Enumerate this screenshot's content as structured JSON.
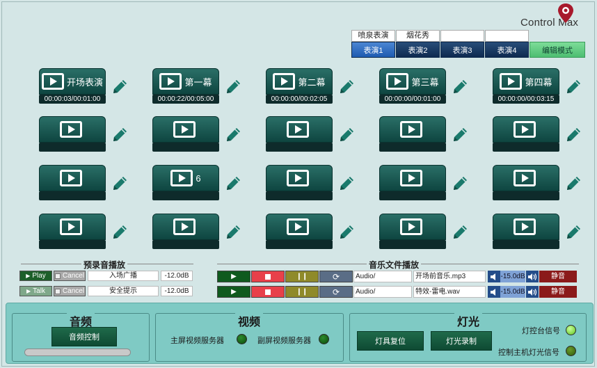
{
  "brand": {
    "logo_text": "Control Max"
  },
  "shows": {
    "names": [
      "喷泉表演",
      "烟花秀",
      "",
      ""
    ],
    "tabs": [
      "表演1",
      "表演2",
      "表演3",
      "表演4"
    ],
    "active_tab": 0,
    "edit_mode_label": "编辑模式"
  },
  "cues": [
    [
      {
        "label": "开场表演",
        "time": "00:00:03/00:01:00"
      },
      {
        "label": "第一幕",
        "time": "00:00:22/00:05:00"
      },
      {
        "label": "第二幕",
        "time": "00:00:00/00:02:05"
      },
      {
        "label": "第三幕",
        "time": "00:00:00/00:01:00"
      },
      {
        "label": "第四幕",
        "time": "00:00:00/00:03:15"
      }
    ],
    [
      {
        "label": "",
        "time": ""
      },
      {
        "label": "",
        "time": ""
      },
      {
        "label": "",
        "time": ""
      },
      {
        "label": "",
        "time": ""
      },
      {
        "label": "",
        "time": ""
      }
    ],
    [
      {
        "label": "",
        "time": ""
      },
      {
        "label": "6",
        "time": ""
      },
      {
        "label": "",
        "time": ""
      },
      {
        "label": "",
        "time": ""
      },
      {
        "label": "",
        "time": ""
      }
    ],
    [
      {
        "label": "",
        "time": ""
      },
      {
        "label": "",
        "time": ""
      },
      {
        "label": "",
        "time": ""
      },
      {
        "label": "",
        "time": ""
      },
      {
        "label": "",
        "time": ""
      }
    ]
  ],
  "prerecorded": {
    "title": "预录音播放",
    "rows": [
      {
        "action": "Play",
        "cancel": "Cancel",
        "name": "入场广播",
        "db": "-12.0dB"
      },
      {
        "action": "Talk",
        "cancel": "Cancel",
        "name": "安全提示",
        "db": "-12.0dB"
      }
    ]
  },
  "music": {
    "title": "音乐文件播放",
    "rows": [
      {
        "path": "Audio/",
        "file": "开场前音乐.mp3",
        "volume": "-15.0dB",
        "mute": "静音"
      },
      {
        "path": "Audio/",
        "file": "特效-雷电.wav",
        "volume": "-15.0dB",
        "mute": "静音"
      }
    ]
  },
  "audio_group": {
    "title": "音频",
    "button": "音频控制"
  },
  "video_group": {
    "title": "视频",
    "main_server": "主屏视频服务器",
    "sub_server": "副屏视频服务器"
  },
  "light_group": {
    "title": "灯光",
    "reset": "灯具复位",
    "record": "灯光录制",
    "console_signal": "灯控台信号",
    "host_signal": "控制主机灯光信号"
  },
  "colors": {
    "accent": "#2a6f67",
    "active_tab": "#1e5bb0",
    "edit_mode": "#4dbe72"
  }
}
